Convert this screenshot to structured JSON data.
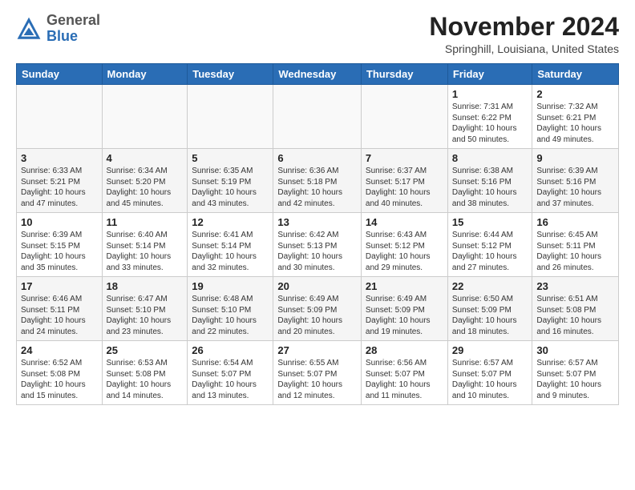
{
  "header": {
    "logo_general": "General",
    "logo_blue": "Blue",
    "month_title": "November 2024",
    "location": "Springhill, Louisiana, United States"
  },
  "days_of_week": [
    "Sunday",
    "Monday",
    "Tuesday",
    "Wednesday",
    "Thursday",
    "Friday",
    "Saturday"
  ],
  "weeks": [
    [
      {
        "day": "",
        "info": ""
      },
      {
        "day": "",
        "info": ""
      },
      {
        "day": "",
        "info": ""
      },
      {
        "day": "",
        "info": ""
      },
      {
        "day": "",
        "info": ""
      },
      {
        "day": "1",
        "info": "Sunrise: 7:31 AM\nSunset: 6:22 PM\nDaylight: 10 hours and 50 minutes."
      },
      {
        "day": "2",
        "info": "Sunrise: 7:32 AM\nSunset: 6:21 PM\nDaylight: 10 hours and 49 minutes."
      }
    ],
    [
      {
        "day": "3",
        "info": "Sunrise: 6:33 AM\nSunset: 5:21 PM\nDaylight: 10 hours and 47 minutes."
      },
      {
        "day": "4",
        "info": "Sunrise: 6:34 AM\nSunset: 5:20 PM\nDaylight: 10 hours and 45 minutes."
      },
      {
        "day": "5",
        "info": "Sunrise: 6:35 AM\nSunset: 5:19 PM\nDaylight: 10 hours and 43 minutes."
      },
      {
        "day": "6",
        "info": "Sunrise: 6:36 AM\nSunset: 5:18 PM\nDaylight: 10 hours and 42 minutes."
      },
      {
        "day": "7",
        "info": "Sunrise: 6:37 AM\nSunset: 5:17 PM\nDaylight: 10 hours and 40 minutes."
      },
      {
        "day": "8",
        "info": "Sunrise: 6:38 AM\nSunset: 5:16 PM\nDaylight: 10 hours and 38 minutes."
      },
      {
        "day": "9",
        "info": "Sunrise: 6:39 AM\nSunset: 5:16 PM\nDaylight: 10 hours and 37 minutes."
      }
    ],
    [
      {
        "day": "10",
        "info": "Sunrise: 6:39 AM\nSunset: 5:15 PM\nDaylight: 10 hours and 35 minutes."
      },
      {
        "day": "11",
        "info": "Sunrise: 6:40 AM\nSunset: 5:14 PM\nDaylight: 10 hours and 33 minutes."
      },
      {
        "day": "12",
        "info": "Sunrise: 6:41 AM\nSunset: 5:14 PM\nDaylight: 10 hours and 32 minutes."
      },
      {
        "day": "13",
        "info": "Sunrise: 6:42 AM\nSunset: 5:13 PM\nDaylight: 10 hours and 30 minutes."
      },
      {
        "day": "14",
        "info": "Sunrise: 6:43 AM\nSunset: 5:12 PM\nDaylight: 10 hours and 29 minutes."
      },
      {
        "day": "15",
        "info": "Sunrise: 6:44 AM\nSunset: 5:12 PM\nDaylight: 10 hours and 27 minutes."
      },
      {
        "day": "16",
        "info": "Sunrise: 6:45 AM\nSunset: 5:11 PM\nDaylight: 10 hours and 26 minutes."
      }
    ],
    [
      {
        "day": "17",
        "info": "Sunrise: 6:46 AM\nSunset: 5:11 PM\nDaylight: 10 hours and 24 minutes."
      },
      {
        "day": "18",
        "info": "Sunrise: 6:47 AM\nSunset: 5:10 PM\nDaylight: 10 hours and 23 minutes."
      },
      {
        "day": "19",
        "info": "Sunrise: 6:48 AM\nSunset: 5:10 PM\nDaylight: 10 hours and 22 minutes."
      },
      {
        "day": "20",
        "info": "Sunrise: 6:49 AM\nSunset: 5:09 PM\nDaylight: 10 hours and 20 minutes."
      },
      {
        "day": "21",
        "info": "Sunrise: 6:49 AM\nSunset: 5:09 PM\nDaylight: 10 hours and 19 minutes."
      },
      {
        "day": "22",
        "info": "Sunrise: 6:50 AM\nSunset: 5:09 PM\nDaylight: 10 hours and 18 minutes."
      },
      {
        "day": "23",
        "info": "Sunrise: 6:51 AM\nSunset: 5:08 PM\nDaylight: 10 hours and 16 minutes."
      }
    ],
    [
      {
        "day": "24",
        "info": "Sunrise: 6:52 AM\nSunset: 5:08 PM\nDaylight: 10 hours and 15 minutes."
      },
      {
        "day": "25",
        "info": "Sunrise: 6:53 AM\nSunset: 5:08 PM\nDaylight: 10 hours and 14 minutes."
      },
      {
        "day": "26",
        "info": "Sunrise: 6:54 AM\nSunset: 5:07 PM\nDaylight: 10 hours and 13 minutes."
      },
      {
        "day": "27",
        "info": "Sunrise: 6:55 AM\nSunset: 5:07 PM\nDaylight: 10 hours and 12 minutes."
      },
      {
        "day": "28",
        "info": "Sunrise: 6:56 AM\nSunset: 5:07 PM\nDaylight: 10 hours and 11 minutes."
      },
      {
        "day": "29",
        "info": "Sunrise: 6:57 AM\nSunset: 5:07 PM\nDaylight: 10 hours and 10 minutes."
      },
      {
        "day": "30",
        "info": "Sunrise: 6:57 AM\nSunset: 5:07 PM\nDaylight: 10 hours and 9 minutes."
      }
    ]
  ]
}
